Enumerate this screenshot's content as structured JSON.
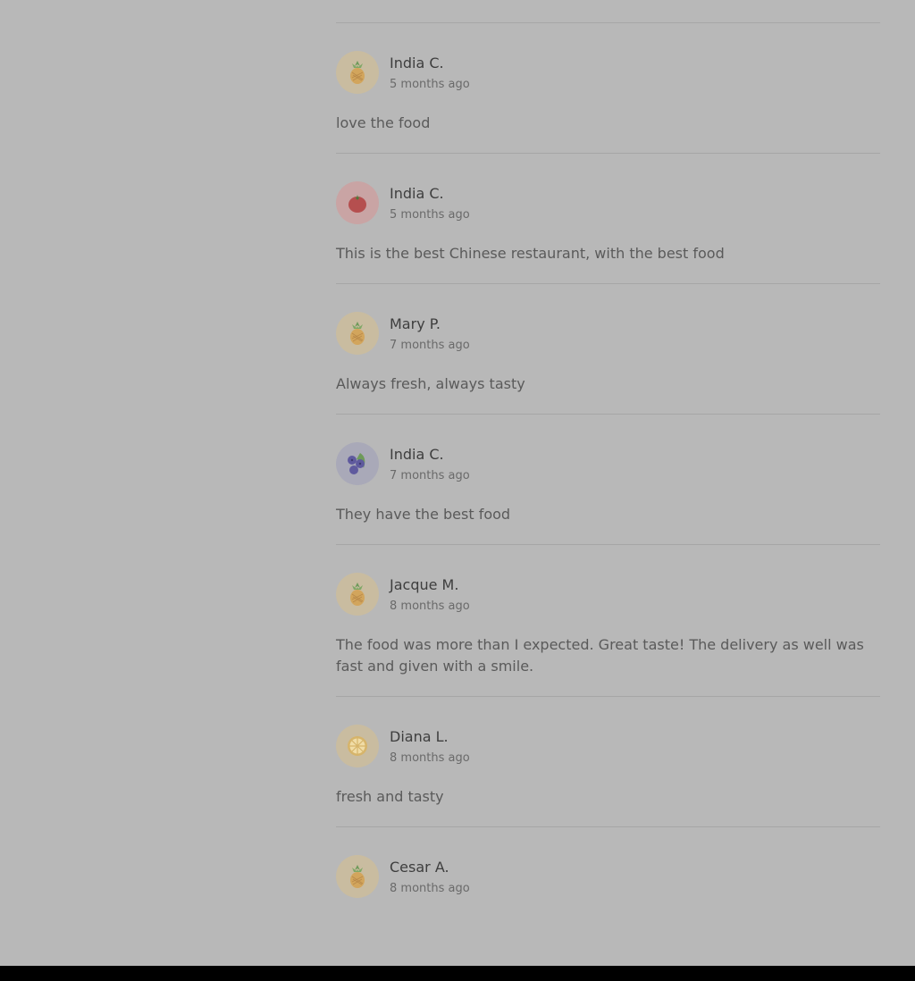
{
  "reviews": [
    {
      "name": "India C.",
      "time": "5 months ago",
      "comment": "love the food",
      "avatar_icon": "pineapple-icon",
      "avatar_bg": "#c9bca0"
    },
    {
      "name": "India C.",
      "time": "5 months ago",
      "comment": "This is the best Chinese restaurant, with the best food",
      "avatar_icon": "tomato-icon",
      "avatar_bg": "#c9a4a4"
    },
    {
      "name": "Mary P.",
      "time": "7 months ago",
      "comment": "Always fresh, always tasty",
      "avatar_icon": "pineapple-icon",
      "avatar_bg": "#c9bca0"
    },
    {
      "name": "India C.",
      "time": "7 months ago",
      "comment": "They have the best food",
      "avatar_icon": "blueberry-icon",
      "avatar_bg": "#a9a9b8"
    },
    {
      "name": "Jacque M.",
      "time": "8 months ago",
      "comment": "The food was more than I expected. Great taste! The delivery as well was fast and given with a smile.",
      "avatar_icon": "pineapple-icon",
      "avatar_bg": "#c9bca0"
    },
    {
      "name": "Diana L.",
      "time": "8 months ago",
      "comment": "fresh and tasty",
      "avatar_icon": "lemon-icon",
      "avatar_bg": "#c9bca0"
    },
    {
      "name": "Cesar A.",
      "time": "8 months ago",
      "comment": "",
      "avatar_icon": "pineapple-icon",
      "avatar_bg": "#c9bca0"
    }
  ]
}
